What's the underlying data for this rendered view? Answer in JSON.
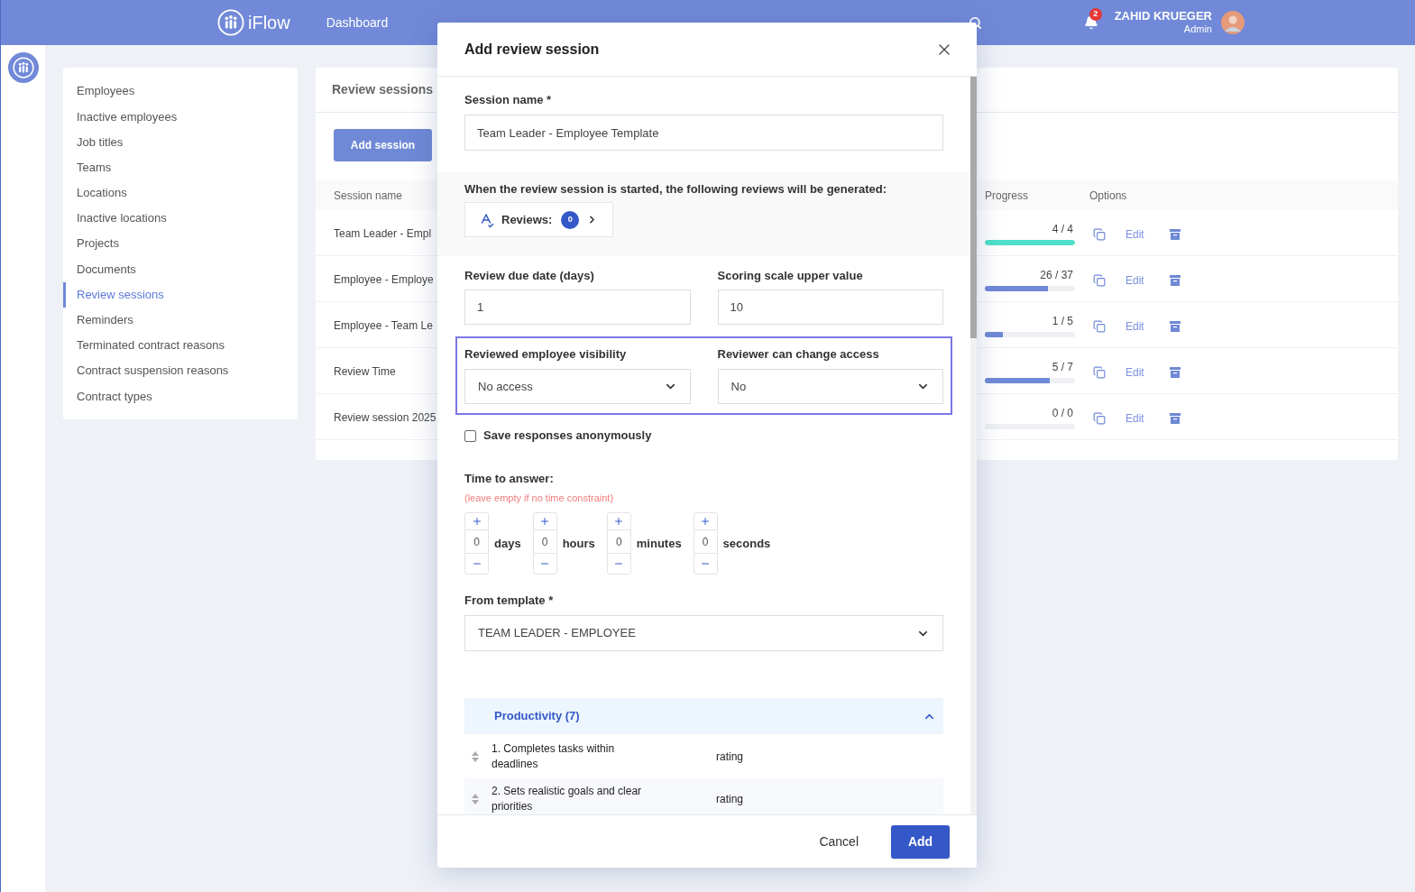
{
  "topbar": {
    "brand": "iFlow",
    "nav": [
      "Dashboard"
    ],
    "notifications": "2",
    "user": {
      "name": "ZAHID KRUEGER",
      "role": "Admin"
    }
  },
  "menu": [
    {
      "label": "Employees",
      "selected": false
    },
    {
      "label": "Inactive employees",
      "selected": false
    },
    {
      "label": "Job titles",
      "selected": false
    },
    {
      "label": "Teams",
      "selected": false
    },
    {
      "label": "Locations",
      "selected": false
    },
    {
      "label": "Inactive locations",
      "selected": false
    },
    {
      "label": "Projects",
      "selected": false
    },
    {
      "label": "Documents",
      "selected": false
    },
    {
      "label": "Review sessions",
      "selected": true
    },
    {
      "label": "Reminders",
      "selected": false
    },
    {
      "label": "Terminated contract reasons",
      "selected": false
    },
    {
      "label": "Contract suspension reasons",
      "selected": false
    },
    {
      "label": "Contract types",
      "selected": false
    }
  ],
  "sessions": {
    "title": "Review sessions",
    "add_button": "Add session",
    "columns": [
      "Session name",
      "Progress",
      "Options"
    ],
    "rows": [
      {
        "name": "Team Leader - Empl",
        "progress": "4 / 4",
        "level": 1,
        "action": "Edit"
      },
      {
        "name": "Employee - Employe",
        "progress": "26 / 37",
        "level": 0.7,
        "action": "Edit"
      },
      {
        "name": "Employee - Team Le",
        "progress": "1 / 5",
        "level": 0.2,
        "action": "Edit"
      },
      {
        "name": "Review Time",
        "progress": "5 / 7",
        "level": 0.72,
        "action": "Edit"
      },
      {
        "name": "Review session 2025",
        "progress": "0 / 0",
        "level": 0,
        "action": "Edit"
      }
    ]
  },
  "modal": {
    "title": "Add review session",
    "session_name": {
      "label": "Session name *",
      "value": "Team Leader - Employee Template"
    },
    "generated": {
      "text": "When the review session is started, the following reviews will be generated:",
      "reviews_label": "Reviews:",
      "reviews_count": "0"
    },
    "due_date": {
      "label": "Review due date (days)",
      "value": "1"
    },
    "scale": {
      "label": "Scoring scale upper value",
      "value": "10"
    },
    "access": {
      "highlighted": true,
      "fields": [
        {
          "label": "Reviewed employee visibility",
          "value": "No access"
        },
        {
          "label": "Reviewer can change access",
          "value": "No"
        }
      ]
    },
    "anonymous": {
      "label": "Save responses anonymously",
      "checked": false
    },
    "time": {
      "label": "Time to answer:",
      "hint": "(leave empty if no time constraint)",
      "units": [
        {
          "value": "0",
          "unit": "days"
        },
        {
          "value": "0",
          "unit": "hours"
        },
        {
          "value": "0",
          "unit": "minutes"
        },
        {
          "value": "0",
          "unit": "seconds"
        }
      ]
    },
    "template": {
      "label": "From template *",
      "value": "TEAM LEADER - EMPLOYEE"
    },
    "sections": [
      {
        "title": "Productivity (7)",
        "expanded": true,
        "questions": [
          {
            "text": "1. Completes tasks within deadlines",
            "type": "rating"
          },
          {
            "text": "2. Sets realistic goals and clear priorities",
            "type": "rating"
          }
        ]
      }
    ],
    "cancel": "Cancel",
    "submit": "Add"
  }
}
